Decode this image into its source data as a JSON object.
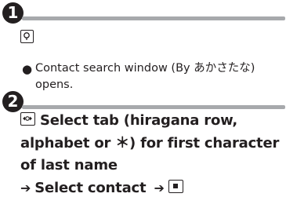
{
  "steps": [
    {
      "number": "1",
      "key_icon": "confirm-key-icon",
      "note": "Contact search window (By あかさたな) opens."
    },
    {
      "number": "2",
      "nav_icon": "multi-selector-key-icon",
      "instruction_part1": "Select tab (hiragana row, alphabet or ＊) for first character of last name",
      "arrow_1": "➔",
      "instruction_part2": "Select contact",
      "arrow_2": "➔",
      "end_icon": "center-key-icon"
    }
  ],
  "colors": {
    "text": "#231f20",
    "rule": "#a7a9ac"
  }
}
